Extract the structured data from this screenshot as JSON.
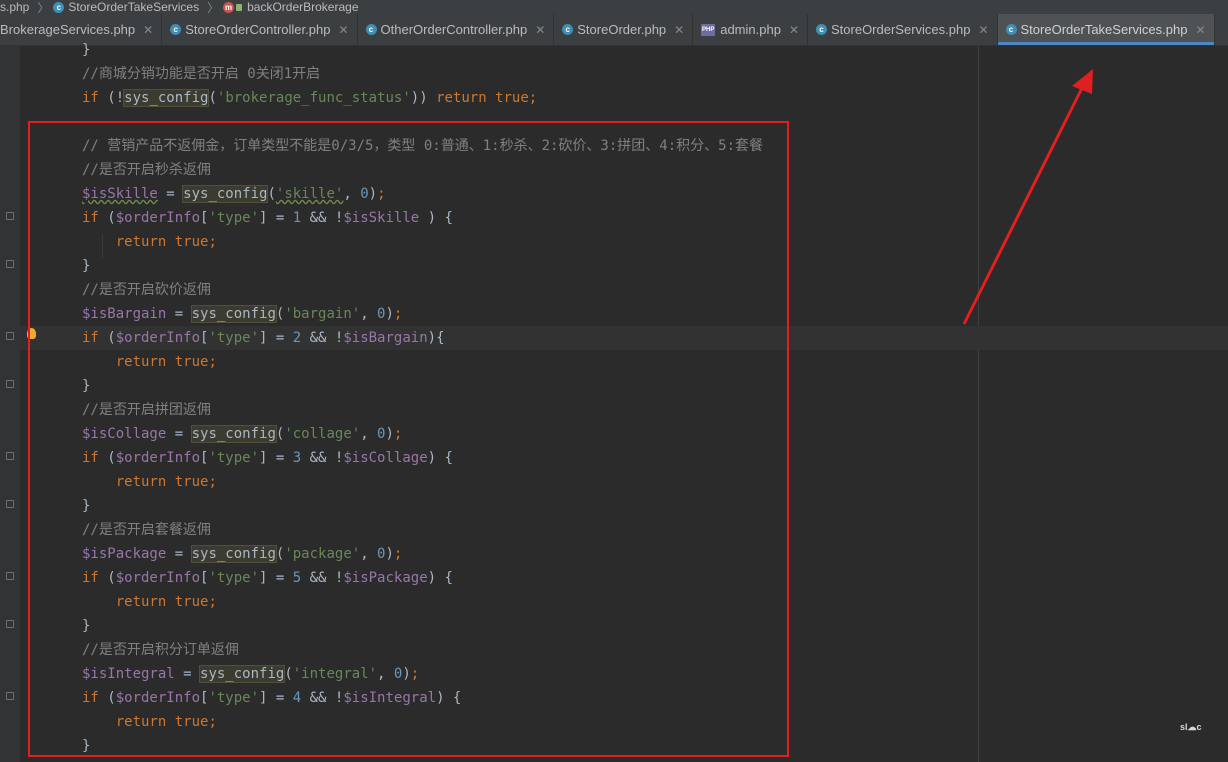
{
  "breadcrumb": {
    "items": [
      "s.php",
      "StoreOrderTakeServices",
      "backOrderBrokerage"
    ]
  },
  "tabs": [
    {
      "label": "BrokerageServices.php",
      "icon": "class-icon",
      "active": false
    },
    {
      "label": "StoreOrderController.php",
      "icon": "class-icon",
      "active": false
    },
    {
      "label": "OtherOrderController.php",
      "icon": "class-icon",
      "active": false
    },
    {
      "label": "StoreOrder.php",
      "icon": "class-icon",
      "active": false
    },
    {
      "label": "admin.php",
      "icon": "php-file-icon",
      "active": false
    },
    {
      "label": "StoreOrderServices.php",
      "icon": "class-icon",
      "active": false
    },
    {
      "label": "StoreOrderTakeServices.php",
      "icon": "class-icon",
      "active": true
    }
  ],
  "code": {
    "brace_close": "}",
    "c1": "//商城分销功能是否开启 0关闭1开启",
    "c_main": "// 营销产品不返佣金，订单类型不能是0/3/5，类型 0:普通、1:秒杀、2:砍价、3:拼团、4:积分、5:套餐",
    "c_skill": "//是否开启秒杀返佣",
    "c_bargain": "//是否开启砍价返佣",
    "c_collage": "//是否开启拼团返佣",
    "c_package": "//是否开启套餐返佣",
    "c_integral": "//是否开启积分订单返佣",
    "kw_if": "if",
    "kw_return": "return",
    "kw_true": "true",
    "fn_sys_config": "sys_config",
    "str_brokerage": "'brokerage_func_status'",
    "var_orderInfo": "$orderInfo",
    "str_type": "'type'",
    "zero": "0",
    "var_isSkille": "$isSkille",
    "str_skille": "'skille'",
    "var_isBargain": "$isBargain",
    "str_bargain": "'bargain'",
    "var_isCollage": "$isCollage",
    "str_collage": "'collage'",
    "var_isPackage": "$isPackage",
    "str_package": "'package'",
    "var_isIntegral": "$isIntegral",
    "str_integral": "'integral'",
    "n1": "1",
    "n2": "2",
    "n3": "3",
    "n4": "4",
    "n5": "5"
  },
  "colors": {
    "annotation_red": "#e02020",
    "active_tab_underline": "#4a88c7"
  },
  "watermark": "sl☁c"
}
